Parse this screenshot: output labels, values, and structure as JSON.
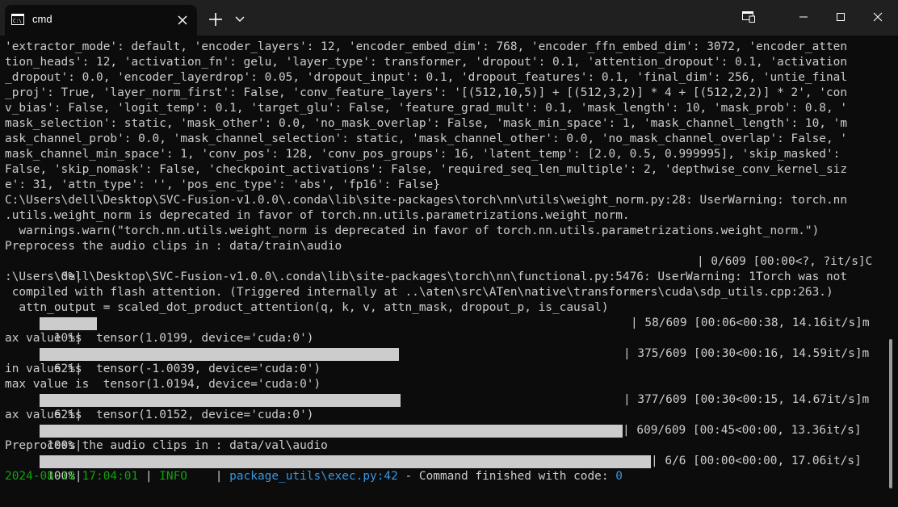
{
  "tab": {
    "icon": "terminal-icon",
    "title": "cmd"
  },
  "colors": {
    "background": "#0c0c0c",
    "titlebar": "#202020",
    "text": "#cccccc",
    "green": "#13a10e",
    "blue": "#3a96dd"
  },
  "terminal": {
    "lines": [
      "'extractor_mode': default, 'encoder_layers': 12, 'encoder_embed_dim': 768, 'encoder_ffn_embed_dim': 3072, 'encoder_atten",
      "tion_heads': 12, 'activation_fn': gelu, 'layer_type': transformer, 'dropout': 0.1, 'attention_dropout': 0.1, 'activation",
      "_dropout': 0.0, 'encoder_layerdrop': 0.05, 'dropout_input': 0.1, 'dropout_features': 0.1, 'final_dim': 256, 'untie_final",
      "_proj': True, 'layer_norm_first': False, 'conv_feature_layers': '[(512,10,5)] + [(512,3,2)] * 4 + [(512,2,2)] * 2', 'con",
      "v_bias': False, 'logit_temp': 0.1, 'target_glu': False, 'feature_grad_mult': 0.1, 'mask_length': 10, 'mask_prob': 0.8, '",
      "mask_selection': static, 'mask_other': 0.0, 'no_mask_overlap': False, 'mask_min_space': 1, 'mask_channel_length': 10, 'm",
      "ask_channel_prob': 0.0, 'mask_channel_selection': static, 'mask_channel_other': 0.0, 'no_mask_channel_overlap': False, '",
      "mask_channel_min_space': 1, 'conv_pos': 128, 'conv_pos_groups': 16, 'latent_temp': [2.0, 0.5, 0.999995], 'skip_masked':",
      "False, 'skip_nomask': False, 'checkpoint_activations': False, 'required_seq_len_multiple': 2, 'depthwise_conv_kernel_siz",
      "e': 31, 'attn_type': '', 'pos_enc_type': 'abs', 'fp16': False}",
      "C:\\Users\\dell\\Desktop\\SVC-Fusion-v1.0.0\\.conda\\lib\\site-packages\\torch\\nn\\utils\\weight_norm.py:28: UserWarning: torch.nn",
      ".utils.weight_norm is deprecated in favor of torch.nn.utils.parametrizations.weight_norm.",
      "  warnings.warn(\"torch.nn.utils.weight_norm is deprecated in favor of torch.nn.utils.parametrizations.weight_norm.\")",
      "Preprocess the audio clips in : data/train\\audio"
    ],
    "progress0": {
      "prefix": "  0%|",
      "tail": "| 0/609 [00:00<?, ?it/s]C",
      "fraction": 0
    },
    "lines2": [
      ":\\Users\\dell\\Desktop\\SVC-Fusion-v1.0.0\\.conda\\lib\\site-packages\\torch\\nn\\functional.py:5476: UserWarning: 1Torch was not",
      " compiled with flash attention. (Triggered internally at ..\\aten\\src\\ATen\\native\\transformers\\cuda\\sdp_utils.cpp:263.)",
      "  attn_output = scaled_dot_product_attention(q, k, v, attn_mask, dropout_p, is_causal)"
    ],
    "progress10": {
      "prefix": " 10%|",
      "tail": "| 58/609 [00:06<00:38, 14.16it/s]m",
      "fraction": 0.1
    },
    "line_after10": "ax value is  tensor(1.0199, device='cuda:0')",
    "progress62a": {
      "prefix": " 62%|",
      "tail": "| 375/609 [00:30<00:16, 14.59it/s]m",
      "fraction": 0.62
    },
    "lines3": [
      "in value is  tensor(-1.0039, device='cuda:0')",
      "max value is  tensor(1.0194, device='cuda:0')"
    ],
    "progress62b": {
      "prefix": " 62%|",
      "tail": "| 377/609 [00:30<00:15, 14.67it/s]m",
      "fraction": 0.62
    },
    "line_after62b": "ax value is  tensor(1.0152, device='cuda:0')",
    "progress100a": {
      "prefix": "100%|",
      "tail": "| 609/609 [00:45<00:00, 13.36it/s]",
      "fraction": 1
    },
    "line_val": "Preprocess the audio clips in : data/val\\audio",
    "progress100b": {
      "prefix": "100%|",
      "tail": "| 6/6 [00:00<00:00, 17.06it/s]",
      "fraction": 1
    },
    "log": {
      "timestamp": "2024-08-18 17:04:01",
      "sep1": " | ",
      "level": "INFO",
      "sep2": "    | ",
      "source": "package_utils\\exec.py:42",
      "message": " - Command finished with code: ",
      "code": "0"
    }
  }
}
